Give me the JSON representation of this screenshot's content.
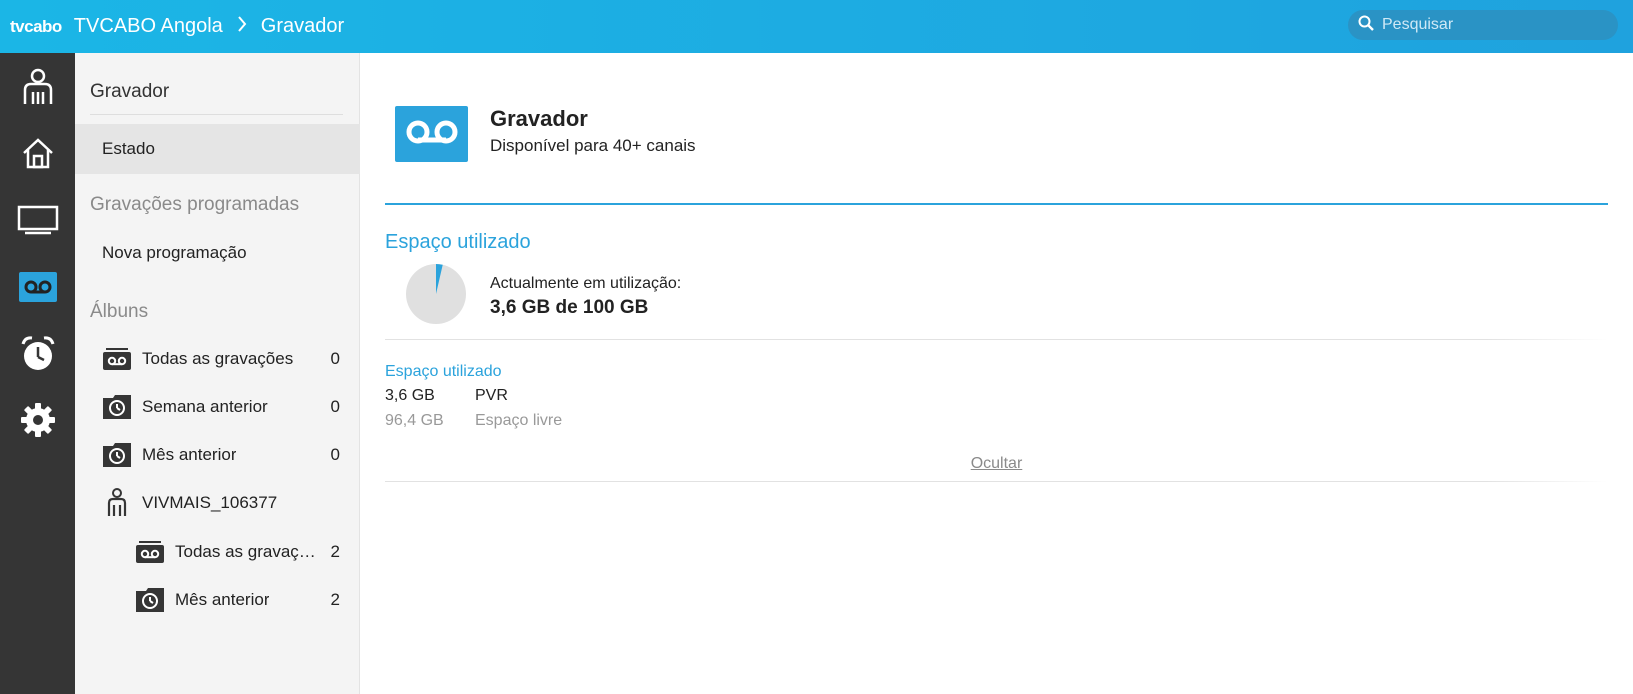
{
  "header": {
    "logo": "tvcabo",
    "breadcrumb": [
      "TVCABO Angola",
      "Gravador"
    ],
    "search_placeholder": "Pesquisar"
  },
  "rail": {
    "items": [
      {
        "icon": "user-profile-icon",
        "active": false
      },
      {
        "icon": "home-icon",
        "active": false
      },
      {
        "icon": "tv-icon",
        "active": false
      },
      {
        "icon": "recorder-icon",
        "active": true
      },
      {
        "icon": "alarm-clock-icon",
        "active": false
      },
      {
        "icon": "gear-icon",
        "active": false
      }
    ]
  },
  "sidebar": {
    "heading": "Gravador",
    "estado": "Estado",
    "scheduled_heading": "Gravações programadas",
    "new_schedule": "Nova programação",
    "albums_heading": "Álbuns",
    "albums": [
      {
        "label": "Todas as gravações",
        "count": "0",
        "icon": "recordings-folder-icon"
      },
      {
        "label": "Semana anterior",
        "count": "0",
        "icon": "history-folder-icon"
      },
      {
        "label": "Mês anterior",
        "count": "0",
        "icon": "history-folder-icon"
      }
    ],
    "user": {
      "label": "VIVMAIS_106377",
      "icon": "person-icon"
    },
    "user_albums": [
      {
        "label": "Todas as gravações",
        "count": "2",
        "icon": "recordings-folder-icon"
      },
      {
        "label": "Mês anterior",
        "count": "2",
        "icon": "history-folder-icon"
      }
    ]
  },
  "main": {
    "title": "Gravador",
    "subtitle": "Disponível para 40+ canais",
    "space_heading": "Espaço utilizado",
    "usage_label": "Actualmente em utilização:",
    "usage_value": "3,6 GB de 100 GB",
    "usage_fraction": 0.036,
    "legend_heading": "Espaço utilizado",
    "legend": [
      {
        "value": "3,6 GB",
        "label": "PVR",
        "color": "#222222"
      },
      {
        "value": "96,4 GB",
        "label": "Espaço livre",
        "color": "#999999"
      }
    ],
    "hide_label": "Ocultar"
  },
  "colors": {
    "accent": "#2ba3dc",
    "header": "#1bb6e6",
    "rail": "#353535",
    "pie_free": "#e0e0e0"
  }
}
